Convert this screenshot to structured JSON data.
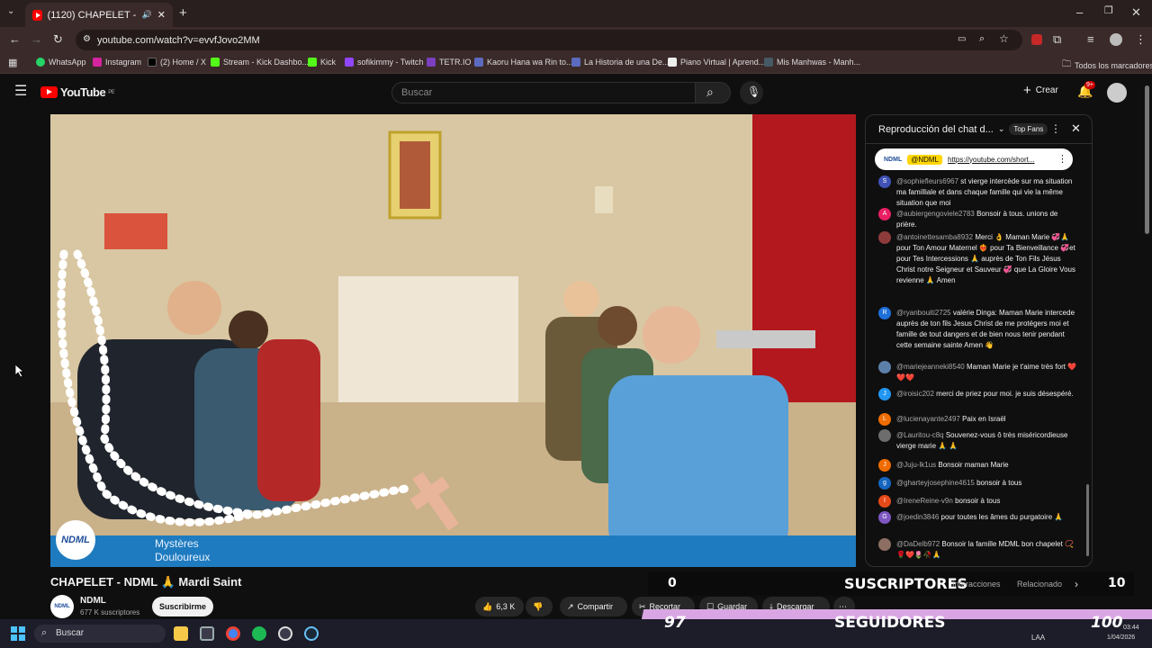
{
  "browser": {
    "tab_title": "(1120) CHAPELET - NDML 🙏 ...",
    "url": "youtube.com/watch?v=evvfJovo2MM",
    "bookmarks": [
      "WhatsApp",
      "Instagram",
      "(2) Home / X",
      "Stream - Kick Dashbo...",
      "Kick",
      "sofikimmy - Twitch",
      "TETR.IO",
      "Kaoru Hana wa Rin to...",
      "La Historia de una De...",
      "Piano Virtual | Aprend...",
      "Mis Manhwas - Manh..."
    ],
    "all_bookmarks": "Todos los marcadores"
  },
  "youtube": {
    "logo_text": "YouTube",
    "country": "PE",
    "search_placeholder": "Buscar",
    "create_label": "Crear",
    "notif_count": "9+"
  },
  "video": {
    "overlay_title": "Mystères",
    "overlay_subtitle": "Douloureux",
    "logo_text": "NDML",
    "title": "CHAPELET - NDML 🙏 Mardi Saint",
    "channel_name": "NDML",
    "channel_subs": "677 K suscriptores",
    "subscribe_label": "Suscribirme",
    "likes": "6,3 K",
    "share_label": "Compartir",
    "clip_label": "Recortar",
    "save_label": "Guardar",
    "download_label": "Descargar"
  },
  "chat": {
    "header": "Reproducción del chat d...",
    "top_fans": "Top Fans",
    "pinned_user": "@NDML",
    "pinned_link": "https://youtube.com/short...",
    "messages": [
      {
        "user": "@sophiefleurs6967",
        "text": "st vierge intercède sur ma situation ma familliale et dans chaque famille qui vie la même situation que moi",
        "color": "#3f51b5",
        "initial": "S"
      },
      {
        "user": "@aubiergengoviele2783",
        "text": "Bonsoir à tous. unions de prière.",
        "color": "#e91e63",
        "initial": "A"
      },
      {
        "user": "@antoinettesamba8932",
        "text": "Merci 👌 Maman Marie 💞🙏 pour Ton Amour Maternel ❤️‍🔥 pour Ta Bienveillance 💞et pour Tes Intercessions 🙏 auprès de Ton Fils Jésus Christ notre Seigneur et Sauveur 💞 que La Gloire Vous revienne 🙏 Amen",
        "color": "#8e3b3b",
        "initial": ""
      },
      {
        "user": "@ryanbouiti2725",
        "text": "valérie Dinga: Maman Marie intercede auprès de ton fils Jesus Christ de me protégers moi et famille de tout dangers et de bien nous tenir pendant cette semaine sainte Amen 👋",
        "color": "#1e6fd9",
        "initial": "R"
      },
      {
        "user": "@mariejeanneki8540",
        "text": "Maman Marie je t'aime très fort ❤️❤️❤️",
        "color": "#5b7fa8",
        "initial": ""
      },
      {
        "user": "@iroisic202",
        "text": "merci de priez pour moi. je suis désespéré.",
        "color": "#2196f3",
        "initial": "J"
      },
      {
        "user": "@lucienayante2497",
        "text": "Paix en Israël",
        "color": "#ef6c00",
        "initial": "L"
      },
      {
        "user": "@Lauritou-c8q",
        "text": "Souvenez-vous ô très miséricordieuse vierge marie 🙏 🙏",
        "color": "#6d6d6d",
        "initial": ""
      },
      {
        "user": "@Juju-lk1us",
        "text": "Bonsoir maman Marie",
        "color": "#ef6c00",
        "initial": "J"
      },
      {
        "user": "@gharteyjosephine4615",
        "text": "bonsoir à tous",
        "color": "#1565c0",
        "initial": "g"
      },
      {
        "user": "@IreneReine-v9n",
        "text": "bonsoir à tous",
        "color": "#e64a19",
        "initial": "I"
      },
      {
        "user": "@joedin3846",
        "text": "pour toutes les âmes du purgatoire 🙏",
        "color": "#7e57c2",
        "initial": "G"
      },
      {
        "user": "@DaDelb972",
        "text": "Bonsoir la famille MDML bon chapelet 📿🌹❤️🌷🥀🙏",
        "color": "#8d6e63",
        "initial": ""
      }
    ]
  },
  "overlays": {
    "subs_left": "0",
    "subs_label": "SUSCRIPTORES",
    "subs_right": "10",
    "tab_interactions": "Interacciones",
    "tab_related": "Relacionado",
    "followers_left": "97",
    "followers_label": "SEGUIDORES",
    "followers_right": "100"
  },
  "taskbar": {
    "search_label": "Buscar",
    "lang": "LAA",
    "time": "03:44",
    "date": "1/04/2026"
  }
}
